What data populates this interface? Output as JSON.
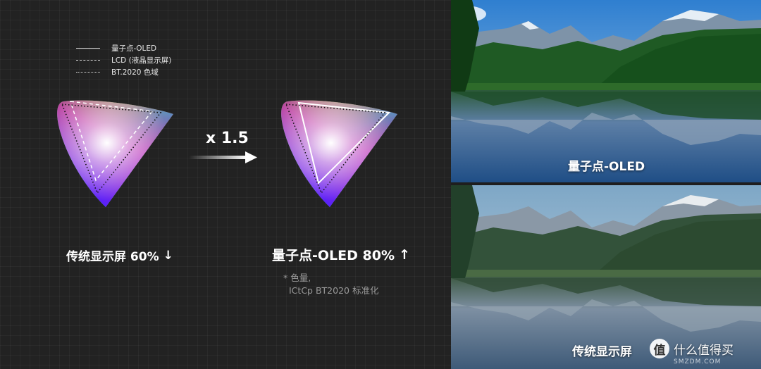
{
  "legend": {
    "items": [
      {
        "label": "量子点-OLED",
        "style": "solid"
      },
      {
        "label": "LCD (液晶显示屏)",
        "style": "dashed"
      },
      {
        "label": "BT.2020 色域",
        "style": "dotted"
      }
    ]
  },
  "comparison": {
    "multiplier": "x 1.5",
    "left_caption": "传统显示屏 60%",
    "left_arrow": "↓",
    "right_caption": "量子点-OLED 80%",
    "right_arrow": "↑",
    "footnote_line1": "* 色量,",
    "footnote_line2": "ICtCp BT2020 标准化"
  },
  "photos": {
    "top_label": "量子点-OLED",
    "bottom_label": "传统显示屏",
    "watermark_icon": "值",
    "watermark_text": "什么值得买",
    "watermark_sub": "SMZDM.COM"
  },
  "colors": {
    "panel_bg": "#222222",
    "arrow": "#ffffff"
  }
}
